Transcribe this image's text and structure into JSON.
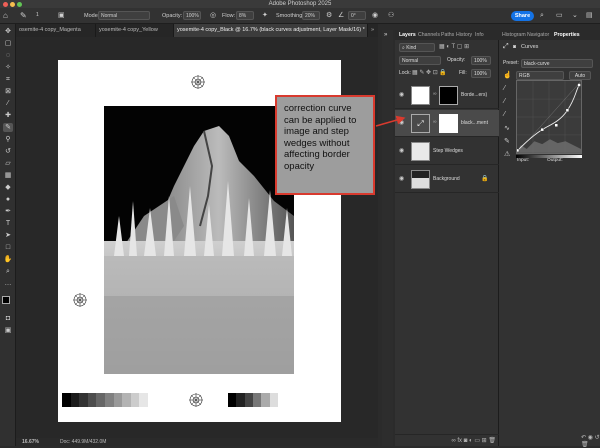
{
  "app": {
    "title": "Adobe Photoshop 2025"
  },
  "options_bar": {
    "mode_label": "Mode:",
    "mode_value": "Normal",
    "opacity_label": "Opacity:",
    "opacity_value": "100%",
    "flow_label": "Flow:",
    "flow_value": "8%",
    "smoothing_label": "Smoothing:",
    "smoothing_value": "20%",
    "angle_value": "0°",
    "brush_size": "1",
    "share_label": "Share"
  },
  "tabs": [
    {
      "label": "osemite-4 copy_Magenta"
    },
    {
      "label": "yosemite-4 copy_Yellow"
    },
    {
      "label": "yosemite-4 copy_Black @ 16.7% (black curves adjustment, Layer Mask/16) *"
    },
    {
      "label": "»"
    }
  ],
  "status": {
    "zoom": "16.67%",
    "doc": "Doc: 449.9M/432.0M"
  },
  "layers_panel": {
    "tabs": [
      "Layers",
      "Channels",
      "Paths",
      "History",
      "Info"
    ],
    "kind_label": "Kind",
    "blend_mode": "Normal",
    "opacity_label": "Opacity:",
    "opacity_value": "100%",
    "lock_label": "Lock:",
    "fill_label": "Fill:",
    "fill_value": "100%",
    "layers": [
      {
        "name": "Borde...ers)"
      },
      {
        "name": "black...ment"
      },
      {
        "name": "Step Wedges"
      },
      {
        "name": "Background"
      }
    ]
  },
  "properties_panel": {
    "tabs": [
      "Histogram",
      "Navigator",
      "Properties"
    ],
    "type_label": "Curves",
    "preset_label": "Preset:",
    "preset_value": "black-curve",
    "channel_value": "RGB",
    "auto_label": "Auto",
    "input_label": "Input:",
    "output_label": "Output:"
  },
  "callout": {
    "text": "correction curve can be applied to image and step wedges without affecting border opacity",
    "border_color": "#d83a2e"
  }
}
